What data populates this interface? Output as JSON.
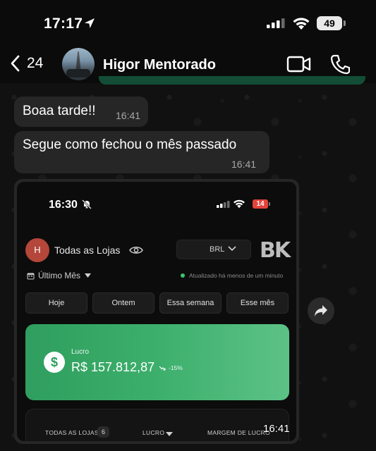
{
  "status_bar": {
    "time": "17:17",
    "battery": "49"
  },
  "header": {
    "back_count": "24",
    "contact_name": "Higor Mentorado"
  },
  "messages": [
    {
      "text": "Boaa tarde!!",
      "time": "16:41"
    },
    {
      "text": "Segue como fechou o mês passado",
      "time": "16:41"
    }
  ],
  "image_message": {
    "time": "16:41",
    "screenshot": {
      "time": "16:30",
      "battery": "14",
      "store_initial": "H",
      "store_name": "Todas as Lojas",
      "currency": "BRL",
      "logo": "BK",
      "period": "Último Mês",
      "updated_text": "Atualizado há menos de um minuto",
      "chips": [
        "Hoje",
        "Ontem",
        "Essa semana",
        "Esse mês"
      ],
      "profit": {
        "label": "Lucro",
        "value": "R$ 157.812,87",
        "delta": "-15%",
        "accent": "#3daf6c"
      },
      "table_columns": {
        "stores": "TODAS AS LOJAS",
        "stores_count": "6",
        "profit": "LUCRO",
        "margin": "MARGEM DE LUCRO"
      }
    }
  },
  "icons": [
    "location-arrow-icon",
    "cellular-icon",
    "wifi-icon",
    "back-chevron-icon",
    "video-call-icon",
    "phone-call-icon",
    "forward-icon",
    "bell-slash-icon",
    "eye-icon",
    "calendar-icon",
    "dollar-icon"
  ]
}
